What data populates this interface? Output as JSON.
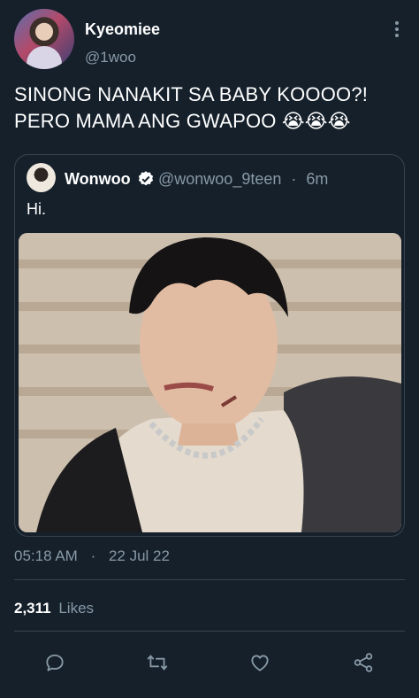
{
  "user": {
    "display_name": "Kyeomiee",
    "handle": "@1woo"
  },
  "tweet": {
    "line1": "SINONG NANAKIT SA BABY KOOOO?!",
    "line2": "PERO MAMA ANG GWAPOO 😭😭😭"
  },
  "quoted": {
    "display_name": "Wonwoo",
    "handle": "@wonwoo_9teen",
    "separator": "·",
    "age": "6m",
    "text": "Hi."
  },
  "meta": {
    "time": "05:18 AM",
    "separator": "·",
    "date": "22 Jul 22"
  },
  "stats": {
    "likes_count": "2,311",
    "likes_label": "Likes"
  },
  "actions": [
    "reply-icon",
    "retweet-icon",
    "like-icon",
    "share-icon"
  ],
  "colors": {
    "background": "#15202b",
    "secondary_text": "#8899a6",
    "border": "#38444d",
    "verified": "#1da1f2"
  }
}
